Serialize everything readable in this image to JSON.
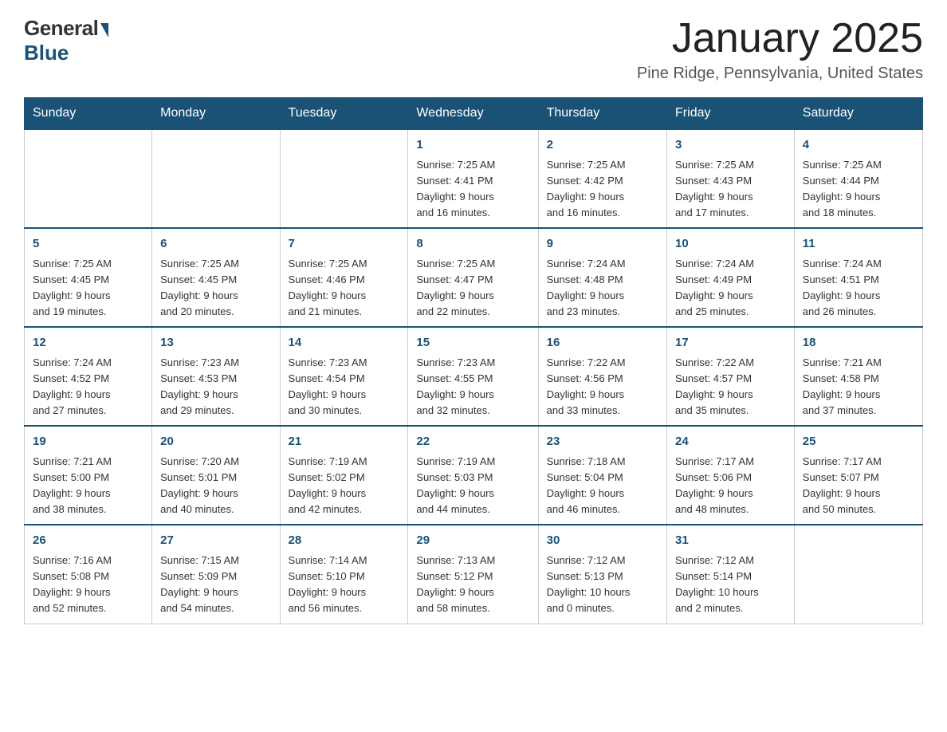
{
  "logo": {
    "general": "General",
    "blue": "Blue"
  },
  "title": {
    "month": "January 2025",
    "location": "Pine Ridge, Pennsylvania, United States"
  },
  "weekdays": [
    "Sunday",
    "Monday",
    "Tuesday",
    "Wednesday",
    "Thursday",
    "Friday",
    "Saturday"
  ],
  "weeks": [
    [
      {
        "day": "",
        "info": ""
      },
      {
        "day": "",
        "info": ""
      },
      {
        "day": "",
        "info": ""
      },
      {
        "day": "1",
        "info": "Sunrise: 7:25 AM\nSunset: 4:41 PM\nDaylight: 9 hours\nand 16 minutes."
      },
      {
        "day": "2",
        "info": "Sunrise: 7:25 AM\nSunset: 4:42 PM\nDaylight: 9 hours\nand 16 minutes."
      },
      {
        "day": "3",
        "info": "Sunrise: 7:25 AM\nSunset: 4:43 PM\nDaylight: 9 hours\nand 17 minutes."
      },
      {
        "day": "4",
        "info": "Sunrise: 7:25 AM\nSunset: 4:44 PM\nDaylight: 9 hours\nand 18 minutes."
      }
    ],
    [
      {
        "day": "5",
        "info": "Sunrise: 7:25 AM\nSunset: 4:45 PM\nDaylight: 9 hours\nand 19 minutes."
      },
      {
        "day": "6",
        "info": "Sunrise: 7:25 AM\nSunset: 4:45 PM\nDaylight: 9 hours\nand 20 minutes."
      },
      {
        "day": "7",
        "info": "Sunrise: 7:25 AM\nSunset: 4:46 PM\nDaylight: 9 hours\nand 21 minutes."
      },
      {
        "day": "8",
        "info": "Sunrise: 7:25 AM\nSunset: 4:47 PM\nDaylight: 9 hours\nand 22 minutes."
      },
      {
        "day": "9",
        "info": "Sunrise: 7:24 AM\nSunset: 4:48 PM\nDaylight: 9 hours\nand 23 minutes."
      },
      {
        "day": "10",
        "info": "Sunrise: 7:24 AM\nSunset: 4:49 PM\nDaylight: 9 hours\nand 25 minutes."
      },
      {
        "day": "11",
        "info": "Sunrise: 7:24 AM\nSunset: 4:51 PM\nDaylight: 9 hours\nand 26 minutes."
      }
    ],
    [
      {
        "day": "12",
        "info": "Sunrise: 7:24 AM\nSunset: 4:52 PM\nDaylight: 9 hours\nand 27 minutes."
      },
      {
        "day": "13",
        "info": "Sunrise: 7:23 AM\nSunset: 4:53 PM\nDaylight: 9 hours\nand 29 minutes."
      },
      {
        "day": "14",
        "info": "Sunrise: 7:23 AM\nSunset: 4:54 PM\nDaylight: 9 hours\nand 30 minutes."
      },
      {
        "day": "15",
        "info": "Sunrise: 7:23 AM\nSunset: 4:55 PM\nDaylight: 9 hours\nand 32 minutes."
      },
      {
        "day": "16",
        "info": "Sunrise: 7:22 AM\nSunset: 4:56 PM\nDaylight: 9 hours\nand 33 minutes."
      },
      {
        "day": "17",
        "info": "Sunrise: 7:22 AM\nSunset: 4:57 PM\nDaylight: 9 hours\nand 35 minutes."
      },
      {
        "day": "18",
        "info": "Sunrise: 7:21 AM\nSunset: 4:58 PM\nDaylight: 9 hours\nand 37 minutes."
      }
    ],
    [
      {
        "day": "19",
        "info": "Sunrise: 7:21 AM\nSunset: 5:00 PM\nDaylight: 9 hours\nand 38 minutes."
      },
      {
        "day": "20",
        "info": "Sunrise: 7:20 AM\nSunset: 5:01 PM\nDaylight: 9 hours\nand 40 minutes."
      },
      {
        "day": "21",
        "info": "Sunrise: 7:19 AM\nSunset: 5:02 PM\nDaylight: 9 hours\nand 42 minutes."
      },
      {
        "day": "22",
        "info": "Sunrise: 7:19 AM\nSunset: 5:03 PM\nDaylight: 9 hours\nand 44 minutes."
      },
      {
        "day": "23",
        "info": "Sunrise: 7:18 AM\nSunset: 5:04 PM\nDaylight: 9 hours\nand 46 minutes."
      },
      {
        "day": "24",
        "info": "Sunrise: 7:17 AM\nSunset: 5:06 PM\nDaylight: 9 hours\nand 48 minutes."
      },
      {
        "day": "25",
        "info": "Sunrise: 7:17 AM\nSunset: 5:07 PM\nDaylight: 9 hours\nand 50 minutes."
      }
    ],
    [
      {
        "day": "26",
        "info": "Sunrise: 7:16 AM\nSunset: 5:08 PM\nDaylight: 9 hours\nand 52 minutes."
      },
      {
        "day": "27",
        "info": "Sunrise: 7:15 AM\nSunset: 5:09 PM\nDaylight: 9 hours\nand 54 minutes."
      },
      {
        "day": "28",
        "info": "Sunrise: 7:14 AM\nSunset: 5:10 PM\nDaylight: 9 hours\nand 56 minutes."
      },
      {
        "day": "29",
        "info": "Sunrise: 7:13 AM\nSunset: 5:12 PM\nDaylight: 9 hours\nand 58 minutes."
      },
      {
        "day": "30",
        "info": "Sunrise: 7:12 AM\nSunset: 5:13 PM\nDaylight: 10 hours\nand 0 minutes."
      },
      {
        "day": "31",
        "info": "Sunrise: 7:12 AM\nSunset: 5:14 PM\nDaylight: 10 hours\nand 2 minutes."
      },
      {
        "day": "",
        "info": ""
      }
    ]
  ]
}
